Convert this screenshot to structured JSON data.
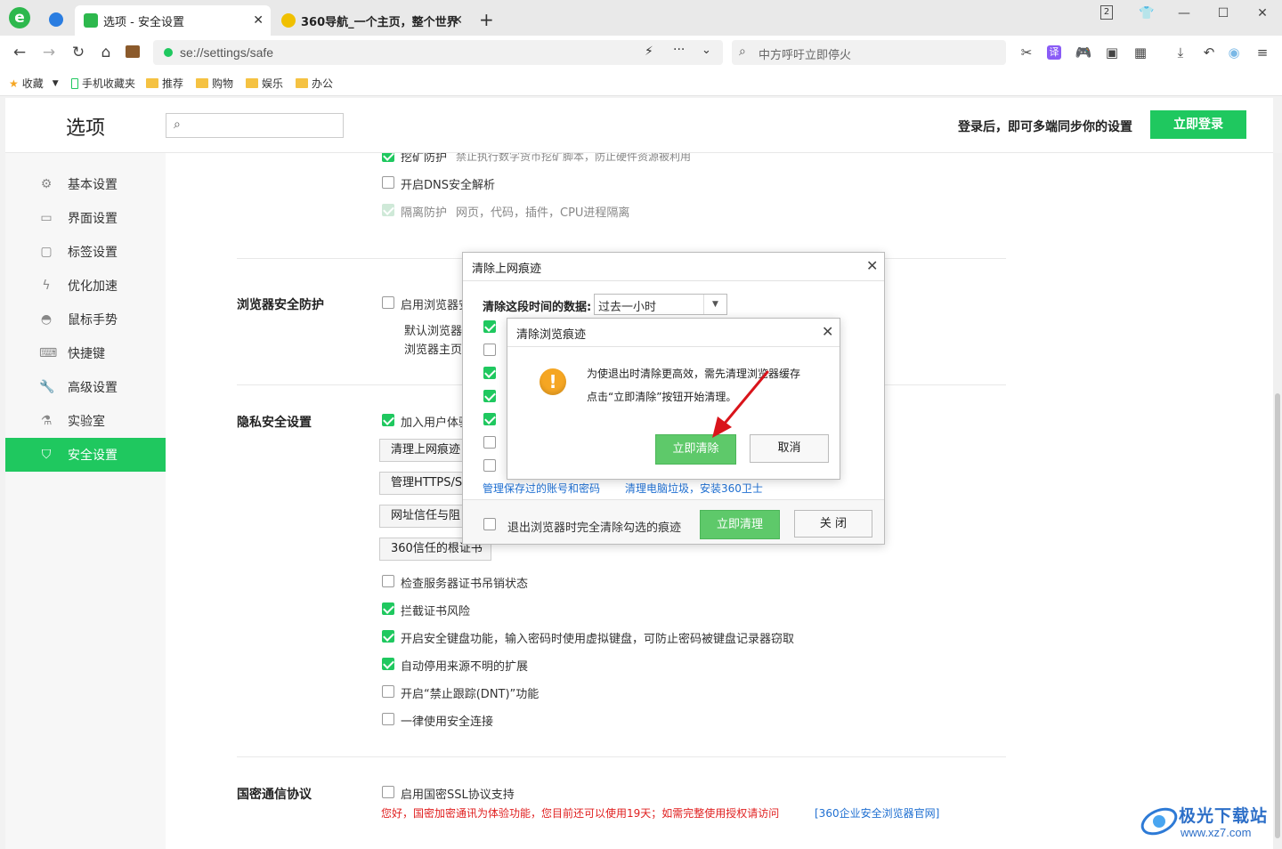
{
  "tabs": [
    {
      "label": "选项 - 安全设置",
      "active": true
    },
    {
      "label": "360导航_一个主页，整个世界",
      "active": false
    }
  ],
  "window": {
    "tab_count": "2"
  },
  "address": {
    "url": "se://settings/safe",
    "search_text": "中方呼吁立即停火"
  },
  "bookmarks": {
    "favorites": "收藏",
    "mobile": "手机收藏夹",
    "folders": [
      "推荐",
      "购物",
      "娱乐",
      "办公"
    ]
  },
  "header": {
    "title": "选项",
    "search_placeholder": "",
    "sync_text": "登录后，即可多端同步你的设置",
    "login_button": "立即登录"
  },
  "sidebar": {
    "items": [
      {
        "label": "基本设置",
        "icon": "gear-icon"
      },
      {
        "label": "界面设置",
        "icon": "window-icon"
      },
      {
        "label": "标签设置",
        "icon": "tab-icon"
      },
      {
        "label": "优化加速",
        "icon": "lightning-icon"
      },
      {
        "label": "鼠标手势",
        "icon": "mouse-icon"
      },
      {
        "label": "快捷键",
        "icon": "keyboard-icon"
      },
      {
        "label": "高级设置",
        "icon": "wrench-icon"
      },
      {
        "label": "实验室",
        "icon": "flask-icon"
      },
      {
        "label": "安全设置",
        "icon": "shield-icon"
      }
    ],
    "active_index": 8
  },
  "content": {
    "top_items": [
      {
        "label": "挖矿防护",
        "desc": "禁止执行数字货币挖矿脚本，防止硬件资源被利用",
        "checked": true
      },
      {
        "label": "开启DNS安全解析",
        "checked": false
      },
      {
        "label": "隔离防护",
        "desc": "网页，代码，插件，CPU进程隔离",
        "checked": true,
        "disabled": true
      }
    ],
    "browser_security": {
      "title": "浏览器安全防护",
      "option": "启用浏览器安",
      "line1": "默认浏览器",
      "line2": "浏览器主页"
    },
    "privacy": {
      "title": "隐私安全设置",
      "join": "加入用户体验",
      "buttons": [
        "清理上网痕迹",
        "管理HTTPS/S",
        "网址信任与阻",
        "360信任的根证书"
      ],
      "options": [
        {
          "label": "检查服务器证书吊销状态",
          "checked": false
        },
        {
          "label": "拦截证书风险",
          "checked": true
        },
        {
          "label": "开启安全键盘功能，输入密码时使用虚拟键盘，可防止密码被键盘记录器窃取",
          "checked": true
        },
        {
          "label": "自动停用来源不明的扩展",
          "checked": true
        },
        {
          "label": "开启“禁止跟踪(DNT)”功能",
          "checked": false
        },
        {
          "label": "一律使用安全连接",
          "checked": false
        }
      ]
    },
    "national": {
      "title": "国密通信协议",
      "option": "启用国密SSL协议支持",
      "notice": "您好，国密加密通讯为体验功能，您目前还可以使用19天；如需完整使用授权请访问",
      "link": "[360企业安全浏览器官网]"
    }
  },
  "dialog_clear": {
    "title": "清除上网痕迹",
    "range_label": "清除这段时间的数据:",
    "range_value": "过去一小时",
    "checkboxes": [
      true,
      false,
      true,
      true,
      true,
      false,
      false
    ],
    "link_accounts": "管理保存过的账号和密码",
    "link_cleanup": "清理电脑垃圾，安装360卫士",
    "exit_option": "退出浏览器时完全清除勾选的痕迹",
    "clean_button": "立即清理",
    "close_button": "关 闭"
  },
  "dialog_confirm": {
    "title": "清除浏览痕迹",
    "line1": "为使退出时清除更高效，需先清理浏览器缓存",
    "line2": "点击“立即清除”按钮开始清理。",
    "confirm_button": "立即清除",
    "cancel_button": "取消"
  },
  "watermark": {
    "brand": "极光下载站",
    "url": "www.xz7.com"
  },
  "colors": {
    "accent": "#1fc85f",
    "dialog_green": "#5ec96a",
    "warning": "#f5a623",
    "link": "#1f6fd1",
    "notice_red": "#e02020",
    "arrow_red": "#d9141b"
  }
}
